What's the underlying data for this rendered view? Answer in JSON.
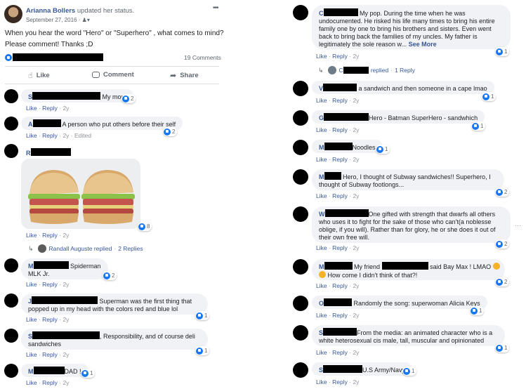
{
  "post": {
    "author": "Arianna Bollers",
    "action": "updated her status.",
    "date": "September 27, 2016",
    "audience": "·",
    "audience_icon": "friends-icon",
    "more": "•••",
    "text1": "When you hear the word \"Hero\" or \"Superhero\" , what comes to mind?",
    "text2": "Please comment! Thanks ;D",
    "comments_count": "19 Comments",
    "like_label": "Like",
    "comment_label": "Comment",
    "share_label": "Share"
  },
  "left": [
    {
      "text": "My mom",
      "time": "2y",
      "react": "2"
    },
    {
      "text": "A person who put others before their self",
      "time": "2y",
      "edited": "Edited",
      "react": "2"
    },
    {
      "time": "2y",
      "react": "8",
      "image": "sandwich-photo",
      "reply_name": "Randall Auguste replied",
      "reply_count": "2 Replies"
    },
    {
      "text": "Spiderman",
      "text2": "MLK Jr.",
      "time": "2y",
      "react": "2"
    },
    {
      "text": "Superman was the first thing that",
      "text2": "popped up in my head with the colors red and blue lol",
      "time": "2y",
      "react": "1"
    },
    {
      "text": ", Responsibility, and of course deli",
      "text2": "sandwiches",
      "time": "2y",
      "react": "1"
    },
    {
      "text": "DAD !",
      "time": "2y",
      "react": "1"
    }
  ],
  "right": [
    {
      "line1": "My pop. During the time when he was",
      "line2": "undocumented. He risked his life many times to bring his entire",
      "line3": "family one by one to bring his brothers and sisters. Even went",
      "line4": "back to bring back the families of my uncles. My father is",
      "line5": "legitimately the sole reason w...",
      "see_more": "See More",
      "time": "2y",
      "react": "1",
      "reply_label": "replied",
      "reply_count": "1 Reply"
    },
    {
      "text": "a sandwich and then someone in a cape lmao",
      "time": "2y",
      "react": "1"
    },
    {
      "text": "Hero - Batman SuperHero - sandwhich",
      "time": "2y",
      "react": "1"
    },
    {
      "text": "Noodles",
      "time": "2y",
      "react": "1"
    },
    {
      "text": "Hero, I thought of Subway sandwiches!! Superhero, I",
      "text2": "thought of Subway footlongs...",
      "time": "2y",
      "react": "2"
    },
    {
      "text": "One gifted with strength that dwarfs all others",
      "text2": "who uses it to fight for the sake of those who can't(a noblesse",
      "text3": "oblige, if you will). Rather than for glory, he or she does it out of",
      "text4": "their own free will.",
      "time": "2y",
      "react": "2"
    },
    {
      "text": "My friend",
      "text_b": "said Bay Max ! LMAO",
      "text2": "How come I didn't think of that?!",
      "time": "2y",
      "react": "2"
    },
    {
      "text": "Randomly the song: superwoman Alicia Keys",
      "time": "2y",
      "react": "1"
    },
    {
      "text": "From the media: an animated character who is a",
      "text2": "white heterosexual cis male, tall, muscular and opinionated",
      "time": "2y",
      "react": "1"
    },
    {
      "text": "U.S Army/Navy",
      "time": "2y",
      "react": "1"
    }
  ],
  "labels": {
    "like": "Like",
    "reply": "Reply",
    "dot": "·"
  }
}
